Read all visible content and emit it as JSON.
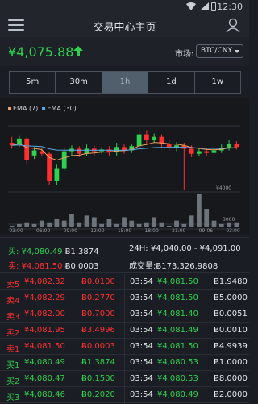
{
  "status_bar": {
    "time": "12:30"
  },
  "header": {
    "title": "交易中心主页"
  },
  "price_bar": {
    "current_price": "¥4,075.88",
    "market_label": "市场:",
    "market_value": "BTC/CNY"
  },
  "tabs": [
    "5m",
    "30m",
    "1h",
    "1d",
    "1w"
  ],
  "active_tab": "1h",
  "colors": {
    "up": "#2fd24f",
    "down": "#ff3030",
    "ema7": "#f0a060",
    "ema30": "#5aa8e8",
    "active_tab": "#515e6c"
  },
  "chart_data": {
    "type": "candlestick",
    "legend": [
      "EMA (7)",
      "EMA (30)"
    ],
    "y_tick_label": "¥4000",
    "y_volume_label": "3000",
    "x_ticks": [
      "03:00",
      "06:00",
      "09:00",
      "12:00",
      "15:00",
      "18:00",
      "21:00",
      "09-06",
      "03:00"
    ],
    "candles": [
      {
        "o": 4005,
        "c": 4002,
        "h": 4012,
        "l": 3998
      },
      {
        "o": 4003,
        "c": 4010,
        "h": 4013,
        "l": 4000
      },
      {
        "o": 4010,
        "c": 3985,
        "h": 4012,
        "l": 3980
      },
      {
        "o": 3990,
        "c": 3996,
        "h": 4000,
        "l": 3986
      },
      {
        "o": 3995,
        "c": 3992,
        "h": 3999,
        "l": 3989
      },
      {
        "o": 3992,
        "c": 3960,
        "h": 3994,
        "l": 3955
      },
      {
        "o": 3960,
        "c": 3975,
        "h": 3980,
        "l": 3955
      },
      {
        "o": 3975,
        "c": 3995,
        "h": 4000,
        "l": 3972
      },
      {
        "o": 3995,
        "c": 3998,
        "h": 4002,
        "l": 3990
      },
      {
        "o": 3998,
        "c": 3992,
        "h": 4001,
        "l": 3988
      },
      {
        "o": 3992,
        "c": 3998,
        "h": 4003,
        "l": 3989
      },
      {
        "o": 3998,
        "c": 3995,
        "h": 4002,
        "l": 3990
      },
      {
        "o": 3995,
        "c": 3997,
        "h": 4000,
        "l": 3992
      },
      {
        "o": 3997,
        "c": 3994,
        "h": 4001,
        "l": 3990
      },
      {
        "o": 3994,
        "c": 4000,
        "h": 4005,
        "l": 3990
      },
      {
        "o": 4000,
        "c": 3996,
        "h": 4003,
        "l": 3992
      },
      {
        "o": 3996,
        "c": 4001,
        "h": 4004,
        "l": 3993
      },
      {
        "o": 4001,
        "c": 4015,
        "h": 4022,
        "l": 3998
      },
      {
        "o": 4015,
        "c": 4008,
        "h": 4020,
        "l": 4004
      },
      {
        "o": 4008,
        "c": 4012,
        "h": 4016,
        "l": 4005
      },
      {
        "o": 4012,
        "c": 4004,
        "h": 4015,
        "l": 4000
      },
      {
        "o": 4004,
        "c": 4000,
        "h": 4008,
        "l": 3996
      },
      {
        "o": 4000,
        "c": 4002,
        "h": 4006,
        "l": 3995
      },
      {
        "o": 4002,
        "c": 3998,
        "h": 4005,
        "l": 3950
      },
      {
        "o": 3998,
        "c": 3992,
        "h": 4002,
        "l": 3988
      },
      {
        "o": 3992,
        "c": 3995,
        "h": 3998,
        "l": 3989
      },
      {
        "o": 3995,
        "c": 3993,
        "h": 3999,
        "l": 3990
      },
      {
        "o": 3993,
        "c": 3996,
        "h": 4000,
        "l": 3991
      },
      {
        "o": 3996,
        "c": 3999,
        "h": 4003,
        "l": 3993
      },
      {
        "o": 3999,
        "c": 4004,
        "h": 4008,
        "l": 3996
      },
      {
        "o": 4004,
        "c": 4000,
        "h": 4007,
        "l": 3997
      }
    ],
    "volumes": [
      1,
      2,
      3,
      2,
      4,
      3,
      5,
      4,
      8,
      3,
      7,
      6,
      2,
      5,
      2,
      6,
      4,
      2,
      3,
      6,
      3,
      1,
      4,
      2,
      7,
      20,
      11,
      4,
      2,
      3,
      3
    ]
  },
  "summary": {
    "buy_label": "买:",
    "buy_price": "¥4,080.49",
    "buy_amount": "Ƀ1.3874",
    "sell_label": "卖:",
    "sell_price": "¥4,081.50",
    "sell_amount": "Ƀ0.0003",
    "range_label": "24H:",
    "range_value": "¥4,040.00 - ¥4,091.00",
    "volume_label": "成交量:",
    "volume_value": "Ƀ173,326.9808"
  },
  "order_book": [
    {
      "label": "卖5",
      "price": "¥4,082.32",
      "amount": "Ƀ0.0100",
      "side": "sell",
      "time": "03:54",
      "t_price": "¥4,081.50",
      "t_amount": "Ƀ1.9480"
    },
    {
      "label": "卖4",
      "price": "¥4,082.29",
      "amount": "Ƀ0.2770",
      "side": "sell",
      "time": "03:54",
      "t_price": "¥4,081.50",
      "t_amount": "Ƀ5.0000"
    },
    {
      "label": "卖3",
      "price": "¥4,082.00",
      "amount": "Ƀ0.7000",
      "side": "sell",
      "time": "03:54",
      "t_price": "¥4,081.40",
      "t_amount": "Ƀ0.0051"
    },
    {
      "label": "卖2",
      "price": "¥4,081.95",
      "amount": "Ƀ3.4996",
      "side": "sell",
      "time": "03:54",
      "t_price": "¥4,081.49",
      "t_amount": "Ƀ0.0010"
    },
    {
      "label": "卖1",
      "price": "¥4,081.50",
      "amount": "Ƀ0.0003",
      "side": "sell",
      "time": "03:54",
      "t_price": "¥4,081.50",
      "t_amount": "Ƀ4.9939"
    },
    {
      "label": "买1",
      "price": "¥4,080.49",
      "amount": "Ƀ1.3874",
      "side": "buy",
      "time": "03:54",
      "t_price": "¥4,080.53",
      "t_amount": "Ƀ1.0000"
    },
    {
      "label": "买2",
      "price": "¥4,080.47",
      "amount": "Ƀ0.1500",
      "side": "buy",
      "time": "03:54",
      "t_price": "¥4,080.53",
      "t_amount": "Ƀ8.0000"
    },
    {
      "label": "买3",
      "price": "¥4,080.46",
      "amount": "Ƀ0.2020",
      "side": "buy",
      "time": "03:54",
      "t_price": "¥4,080.49",
      "t_amount": "Ƀ2.0000"
    }
  ]
}
